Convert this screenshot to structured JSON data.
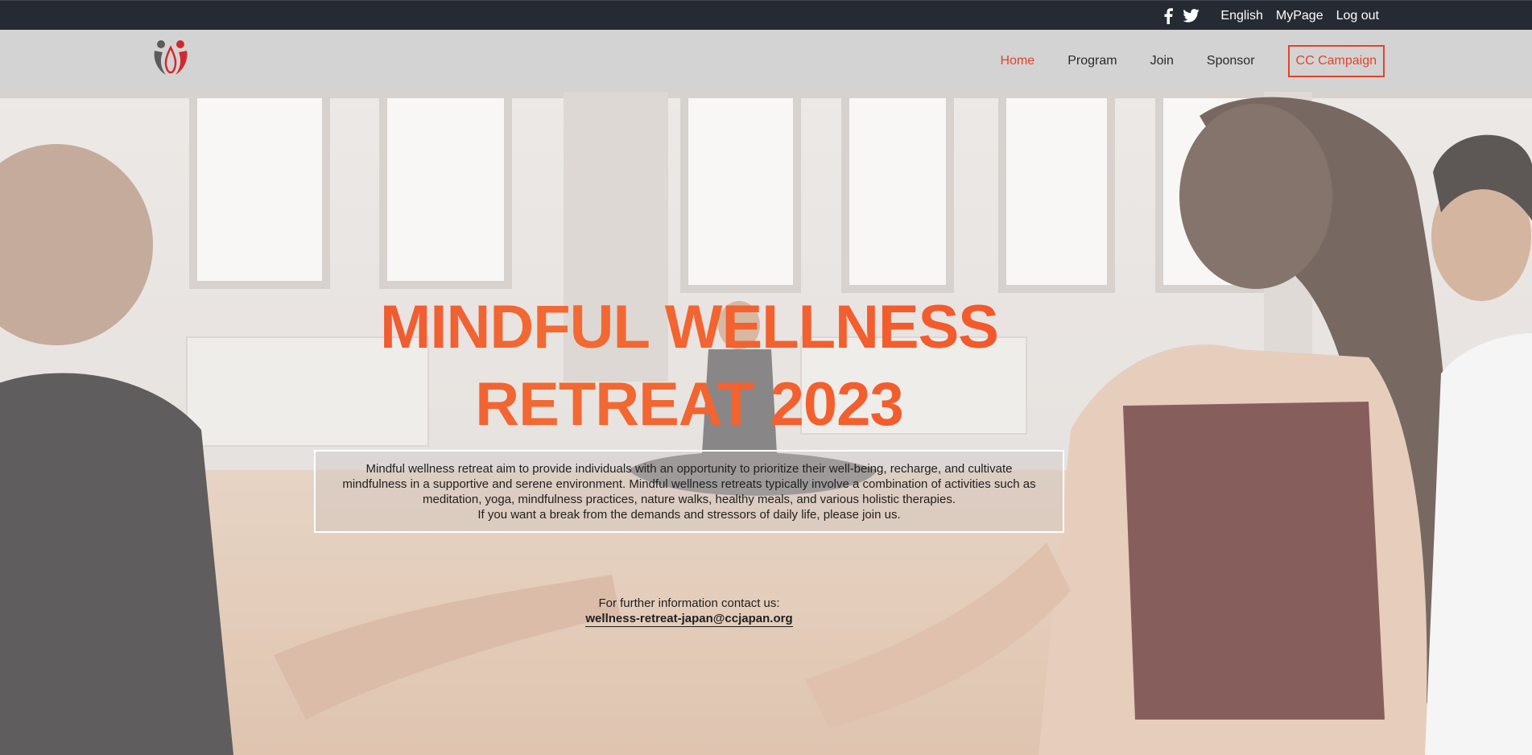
{
  "topbar": {
    "social": [
      {
        "icon": "facebook-icon",
        "label": "Facebook"
      },
      {
        "icon": "twitter-icon",
        "label": "Twitter"
      }
    ],
    "links": [
      "English",
      "MyPage",
      "Log out"
    ]
  },
  "header": {
    "logo_icon": "retreat-logo-icon",
    "nav": {
      "home": "Home",
      "program": "Program",
      "join": "Join",
      "sponsor": "Sponsor",
      "cta": "CC Campaign"
    }
  },
  "hero": {
    "title_line1": "MINDFUL WELLNESS",
    "title_line2": "RETREAT 2023",
    "description": [
      "Mindful wellness retreat aim to provide individuals with an opportunity to prioritize their well-being, recharge, and cultivate",
      "mindfulness in a supportive and serene environment. Mindful wellness retreats typically involve a combination of activities such as",
      "meditation, yoga, mindfulness practices, nature walks, healthy meals, and various holistic therapies.",
      "If you want a break from the demands and stressors of daily life, please join us."
    ],
    "contact_label": "For further information contact us:",
    "contact_email": "wellness-retreat-japan@ccjapan.org"
  },
  "colors": {
    "accent": "#e0452b",
    "topbar_bg": "#262a33",
    "header_bg": "#d3d3d3"
  }
}
